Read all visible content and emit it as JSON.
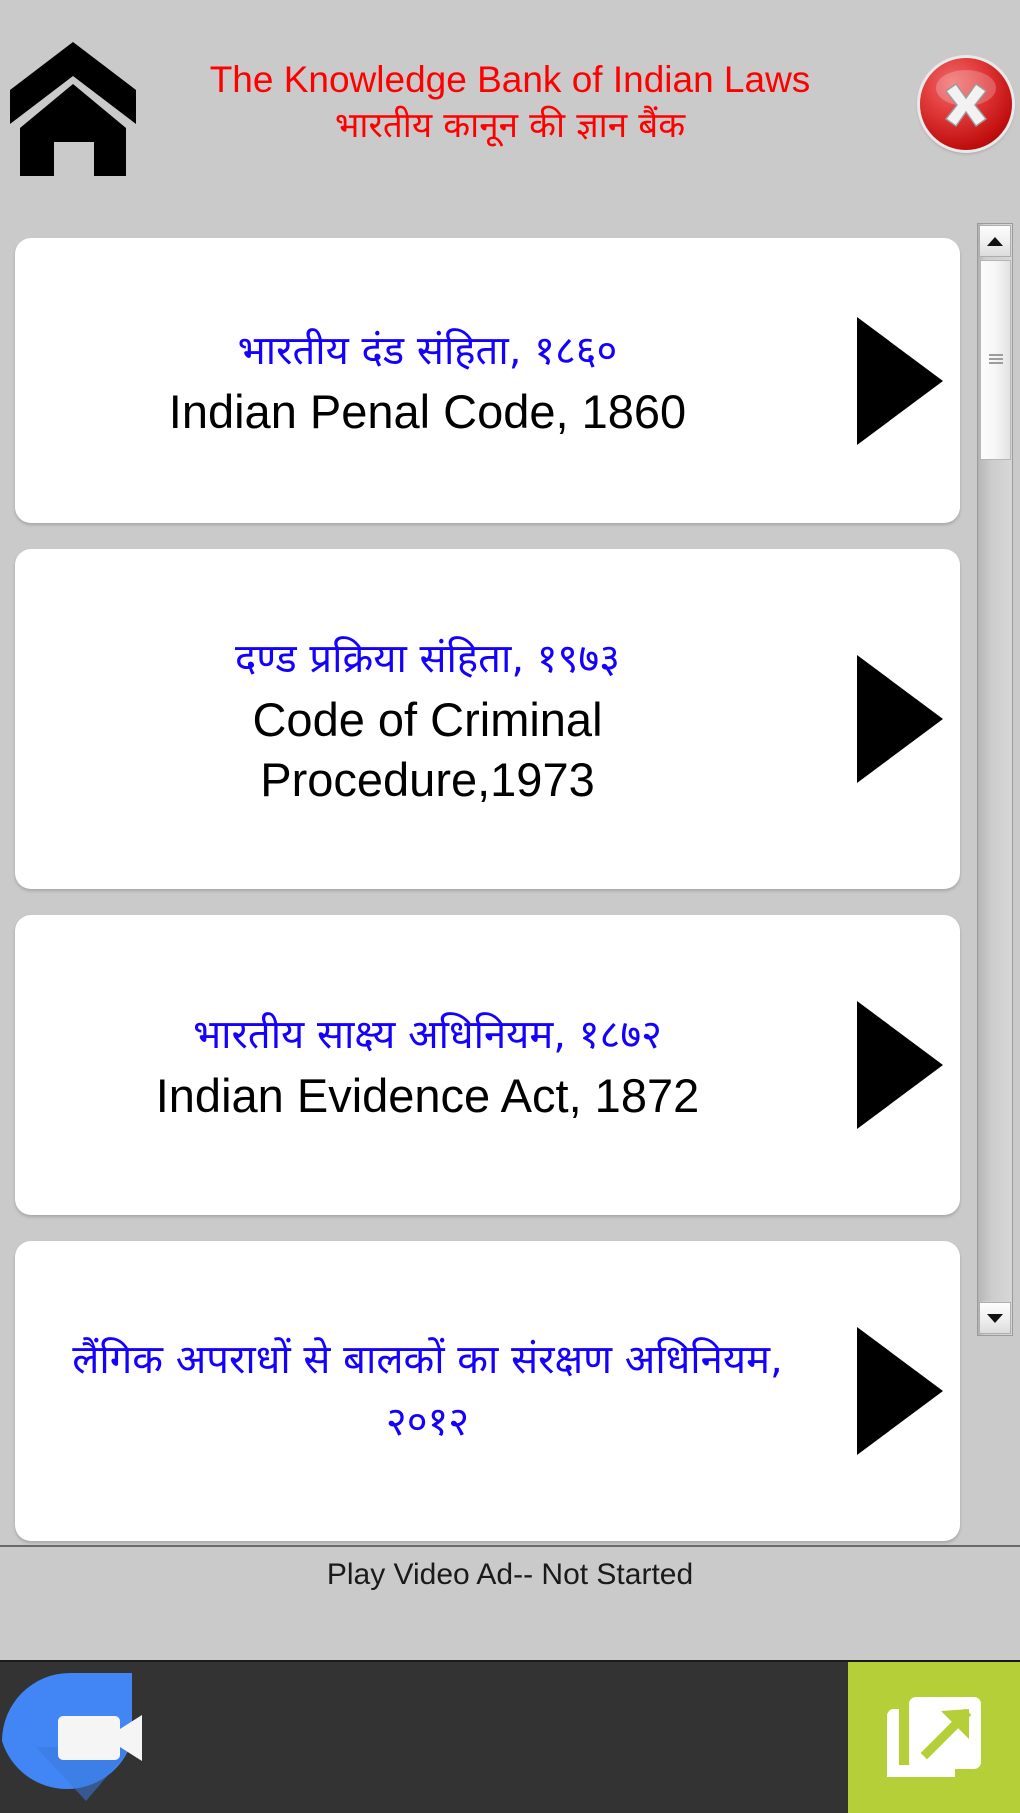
{
  "header": {
    "home_icon": "home-icon",
    "title_en": "The Knowledge Bank of Indian Laws",
    "title_hi": "भारतीय कानून की ज्ञान बैंक",
    "title_color": "#ff0000",
    "close_icon": "close-x-icon",
    "close_label": "X"
  },
  "list": {
    "items": [
      {
        "hi": "भारतीय दंड संहिता, १८६०",
        "en": "Indian Penal Code, 1860",
        "arrow": "play-triangle-icon"
      },
      {
        "hi": "दण्ड प्रक्रिया संहिता, १९७३",
        "en": "Code of Criminal\nProcedure,1973",
        "arrow": "play-triangle-icon"
      },
      {
        "hi": "भारतीय साक्ष्य अधिनियम, १८७२",
        "en": "Indian Evidence Act, 1872",
        "arrow": "play-triangle-icon"
      },
      {
        "hi": "लैंगिक अपराधों से बालकों का संरक्षण अधिनियम, २०१२",
        "en": "",
        "arrow": "play-triangle-icon"
      }
    ],
    "hindi_color": "#1400ff",
    "english_color": "#000000",
    "card_background": "#ffffff"
  },
  "scrollbar": {
    "up_icon": "scroll-up-arrow-icon",
    "down_icon": "scroll-down-arrow-icon",
    "thumb_icon": "scroll-thumb-grip"
  },
  "ad": {
    "status_text": "Play Video Ad-- Not Started"
  },
  "bottom_bar": {
    "background": "#333333",
    "duo_icon": "video-call-icon",
    "share_icon": "open-external-icon",
    "share_background": "#b5cf38"
  }
}
